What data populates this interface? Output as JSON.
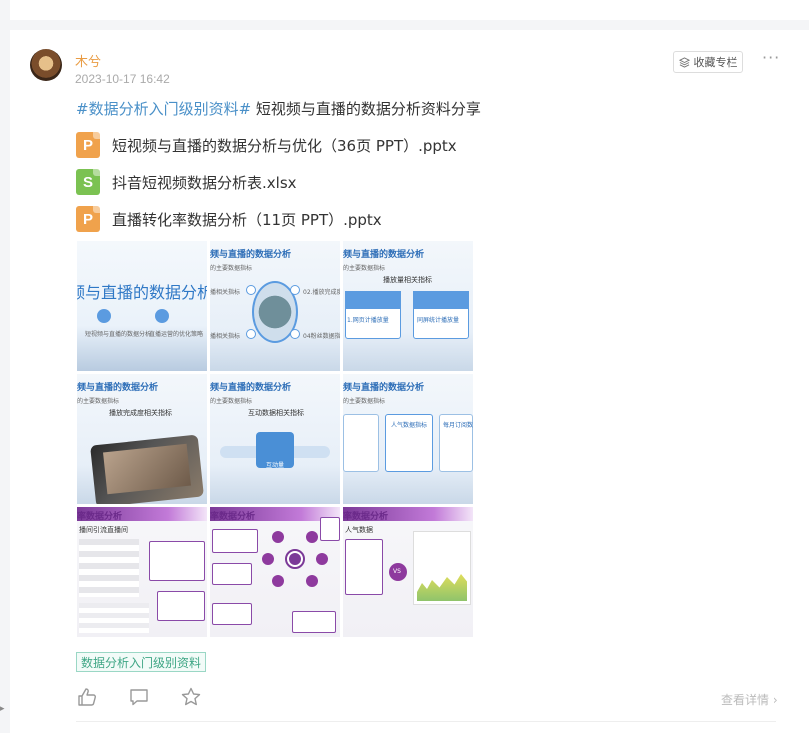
{
  "post": {
    "author": "木兮",
    "timestamp": "2023-10-17 16:42",
    "collect_label": "收藏专栏",
    "more_label": "···",
    "title_hashtag": "#数据分析入门级别资料#",
    "title_text": " 短视频与直播的数据分析资料分享",
    "files": [
      {
        "icon": "P",
        "type": "ppt",
        "name": "短视频与直播的数据分析与优化（36页 PPT）.pptx"
      },
      {
        "icon": "S",
        "type": "xls",
        "name": "抖音短视频数据分析表.xlsx"
      },
      {
        "icon": "P",
        "type": "ppt",
        "name": "直播转化率数据分析（11页 PPT）.pptx"
      }
    ],
    "thumbnails": {
      "t1": {
        "big": "频与直播的数据分析与",
        "c1": "短视频与直播的数据分析",
        "c2": "直播运营的优化策略"
      },
      "t2": {
        "hd": "频与直播的数据分析",
        "sub": "的主要数据指标",
        "l1": "播相关指标",
        "l2": "02.播放完成度",
        "l3": "播相关指标",
        "l4": "04粉丝数据指标"
      },
      "t3": {
        "hd": "频与直播的数据分析",
        "sub": "的主要数据指标",
        "h": "播放量相关指标",
        "b1": "1.网页计播放量",
        "b2": "同屏统计播放量"
      },
      "t4": {
        "hd": "频与直播的数据分析",
        "sub": "的主要数据指标",
        "h": "播放完成度相关指标"
      },
      "t5": {
        "hd": "频与直播的数据分析",
        "sub": "的主要数据指标",
        "h": "互动数据相关指标",
        "center": "互动量"
      },
      "t6": {
        "hd": "频与直播的数据分析",
        "sub": "的主要数据指标",
        "m": "人气数据指标",
        "r": "每月订阅数"
      },
      "t7": {
        "hd": "率数据分析",
        "sub": "播间引流直播间"
      },
      "t8": {
        "hd": "率数据分析"
      },
      "t9": {
        "hd": "率数据分析",
        "sub": "人气数据",
        "vs": "VS"
      }
    },
    "tag": "数据分析入门级别资料",
    "view_detail": "查看详情",
    "view_detail_arrow": "›"
  },
  "colors": {
    "author": "#e99c44",
    "hashtag": "#4a90c8",
    "ppt_icon": "#f0a24c",
    "xls_icon": "#7bc252",
    "tag_text": "#3fa685"
  }
}
